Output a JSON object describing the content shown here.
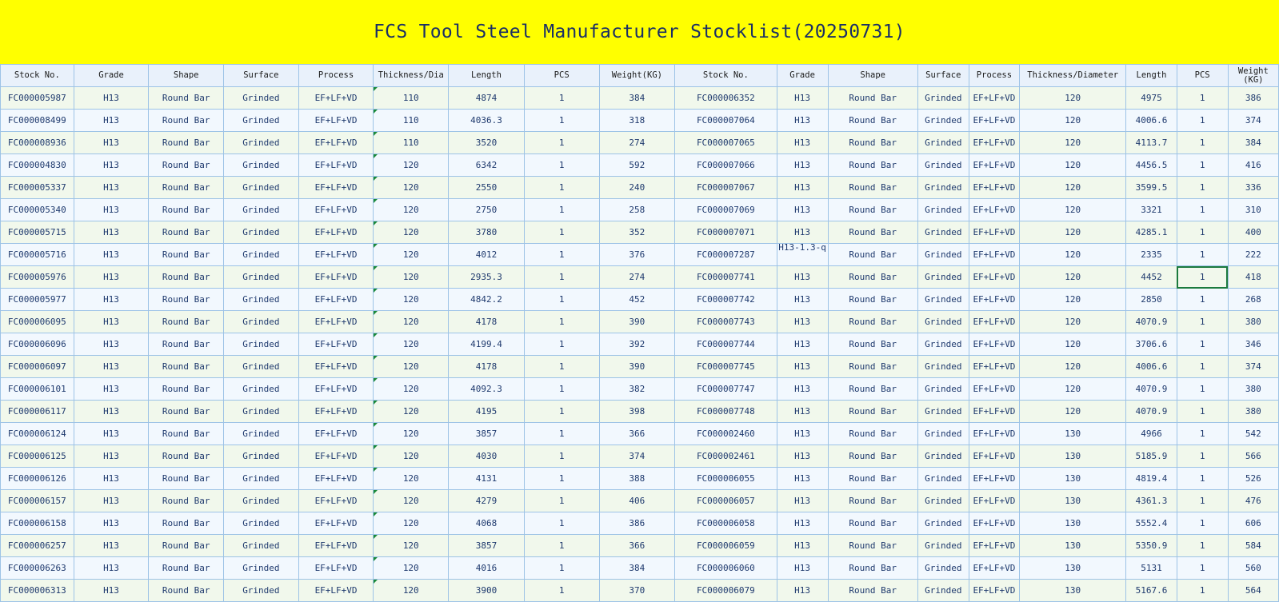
{
  "title": "FCS Tool Steel Manufacturer Stocklist(20250731)",
  "headers": [
    "Stock No.",
    "Grade",
    "Shape",
    "Surface",
    "Process",
    "Thickness/Dia",
    "Length",
    "PCS",
    "Weight(KG)",
    "Stock No.",
    "Grade",
    "Shape",
    "Surface",
    "Process",
    "Thickness/Diameter",
    "Length",
    "PCS",
    "Weight (KG)"
  ],
  "rows": [
    [
      "FC000005987",
      "H13",
      "Round Bar",
      "Grinded",
      "EF+LF+VD",
      "110",
      "4874",
      "1",
      "384",
      "FC000006352",
      "H13",
      "Round Bar",
      "Grinded",
      "EF+LF+VD",
      "120",
      "4975",
      "1",
      "386"
    ],
    [
      "FC000008499",
      "H13",
      "Round Bar",
      "Grinded",
      "EF+LF+VD",
      "110",
      "4036.3",
      "1",
      "318",
      "FC000007064",
      "H13",
      "Round Bar",
      "Grinded",
      "EF+LF+VD",
      "120",
      "4006.6",
      "1",
      "374"
    ],
    [
      "FC000008936",
      "H13",
      "Round Bar",
      "Grinded",
      "EF+LF+VD",
      "110",
      "3520",
      "1",
      "274",
      "FC000007065",
      "H13",
      "Round Bar",
      "Grinded",
      "EF+LF+VD",
      "120",
      "4113.7",
      "1",
      "384"
    ],
    [
      "FC000004830",
      "H13",
      "Round Bar",
      "Grinded",
      "EF+LF+VD",
      "120",
      "6342",
      "1",
      "592",
      "FC000007066",
      "H13",
      "Round Bar",
      "Grinded",
      "EF+LF+VD",
      "120",
      "4456.5",
      "1",
      "416"
    ],
    [
      "FC000005337",
      "H13",
      "Round Bar",
      "Grinded",
      "EF+LF+VD",
      "120",
      "2550",
      "1",
      "240",
      "FC000007067",
      "H13",
      "Round Bar",
      "Grinded",
      "EF+LF+VD",
      "120",
      "3599.5",
      "1",
      "336"
    ],
    [
      "FC000005340",
      "H13",
      "Round Bar",
      "Grinded",
      "EF+LF+VD",
      "120",
      "2750",
      "1",
      "258",
      "FC000007069",
      "H13",
      "Round Bar",
      "Grinded",
      "EF+LF+VD",
      "120",
      "3321",
      "1",
      "310"
    ],
    [
      "FC000005715",
      "H13",
      "Round Bar",
      "Grinded",
      "EF+LF+VD",
      "120",
      "3780",
      "1",
      "352",
      "FC000007071",
      "H13",
      "Round Bar",
      "Grinded",
      "EF+LF+VD",
      "120",
      "4285.1",
      "1",
      "400"
    ],
    [
      "FC000005716",
      "H13",
      "Round Bar",
      "Grinded",
      "EF+LF+VD",
      "120",
      "4012",
      "1",
      "376",
      "FC000007287",
      "H13-1.3-q",
      "Round Bar",
      "Grinded",
      "EF+LF+VD",
      "120",
      "2335",
      "1",
      "222"
    ],
    [
      "FC000005976",
      "H13",
      "Round Bar",
      "Grinded",
      "EF+LF+VD",
      "120",
      "2935.3",
      "1",
      "274",
      "FC000007741",
      "H13",
      "Round Bar",
      "Grinded",
      "EF+LF+VD",
      "120",
      "4452",
      "1",
      "418"
    ],
    [
      "FC000005977",
      "H13",
      "Round Bar",
      "Grinded",
      "EF+LF+VD",
      "120",
      "4842.2",
      "1",
      "452",
      "FC000007742",
      "H13",
      "Round Bar",
      "Grinded",
      "EF+LF+VD",
      "120",
      "2850",
      "1",
      "268"
    ],
    [
      "FC000006095",
      "H13",
      "Round Bar",
      "Grinded",
      "EF+LF+VD",
      "120",
      "4178",
      "1",
      "390",
      "FC000007743",
      "H13",
      "Round Bar",
      "Grinded",
      "EF+LF+VD",
      "120",
      "4070.9",
      "1",
      "380"
    ],
    [
      "FC000006096",
      "H13",
      "Round Bar",
      "Grinded",
      "EF+LF+VD",
      "120",
      "4199.4",
      "1",
      "392",
      "FC000007744",
      "H13",
      "Round Bar",
      "Grinded",
      "EF+LF+VD",
      "120",
      "3706.6",
      "1",
      "346"
    ],
    [
      "FC000006097",
      "H13",
      "Round Bar",
      "Grinded",
      "EF+LF+VD",
      "120",
      "4178",
      "1",
      "390",
      "FC000007745",
      "H13",
      "Round Bar",
      "Grinded",
      "EF+LF+VD",
      "120",
      "4006.6",
      "1",
      "374"
    ],
    [
      "FC000006101",
      "H13",
      "Round Bar",
      "Grinded",
      "EF+LF+VD",
      "120",
      "4092.3",
      "1",
      "382",
      "FC000007747",
      "H13",
      "Round Bar",
      "Grinded",
      "EF+LF+VD",
      "120",
      "4070.9",
      "1",
      "380"
    ],
    [
      "FC000006117",
      "H13",
      "Round Bar",
      "Grinded",
      "EF+LF+VD",
      "120",
      "4195",
      "1",
      "398",
      "FC000007748",
      "H13",
      "Round Bar",
      "Grinded",
      "EF+LF+VD",
      "120",
      "4070.9",
      "1",
      "380"
    ],
    [
      "FC000006124",
      "H13",
      "Round Bar",
      "Grinded",
      "EF+LF+VD",
      "120",
      "3857",
      "1",
      "366",
      "FC000002460",
      "H13",
      "Round Bar",
      "Grinded",
      "EF+LF+VD",
      "130",
      "4966",
      "1",
      "542"
    ],
    [
      "FC000006125",
      "H13",
      "Round Bar",
      "Grinded",
      "EF+LF+VD",
      "120",
      "4030",
      "1",
      "374",
      "FC000002461",
      "H13",
      "Round Bar",
      "Grinded",
      "EF+LF+VD",
      "130",
      "5185.9",
      "1",
      "566"
    ],
    [
      "FC000006126",
      "H13",
      "Round Bar",
      "Grinded",
      "EF+LF+VD",
      "120",
      "4131",
      "1",
      "388",
      "FC000006055",
      "H13",
      "Round Bar",
      "Grinded",
      "EF+LF+VD",
      "130",
      "4819.4",
      "1",
      "526"
    ],
    [
      "FC000006157",
      "H13",
      "Round Bar",
      "Grinded",
      "EF+LF+VD",
      "120",
      "4279",
      "1",
      "406",
      "FC000006057",
      "H13",
      "Round Bar",
      "Grinded",
      "EF+LF+VD",
      "130",
      "4361.3",
      "1",
      "476"
    ],
    [
      "FC000006158",
      "H13",
      "Round Bar",
      "Grinded",
      "EF+LF+VD",
      "120",
      "4068",
      "1",
      "386",
      "FC000006058",
      "H13",
      "Round Bar",
      "Grinded",
      "EF+LF+VD",
      "130",
      "5552.4",
      "1",
      "606"
    ],
    [
      "FC000006257",
      "H13",
      "Round Bar",
      "Grinded",
      "EF+LF+VD",
      "120",
      "3857",
      "1",
      "366",
      "FC000006059",
      "H13",
      "Round Bar",
      "Grinded",
      "EF+LF+VD",
      "130",
      "5350.9",
      "1",
      "584"
    ],
    [
      "FC000006263",
      "H13",
      "Round Bar",
      "Grinded",
      "EF+LF+VD",
      "120",
      "4016",
      "1",
      "384",
      "FC000006060",
      "H13",
      "Round Bar",
      "Grinded",
      "EF+LF+VD",
      "130",
      "5131",
      "1",
      "560"
    ],
    [
      "FC000006313",
      "H13",
      "Round Bar",
      "Grinded",
      "EF+LF+VD",
      "120",
      "3900",
      "1",
      "370",
      "FC000006079",
      "H13",
      "Round Bar",
      "Grinded",
      "EF+LF+VD",
      "130",
      "5167.6",
      "1",
      "564"
    ]
  ]
}
